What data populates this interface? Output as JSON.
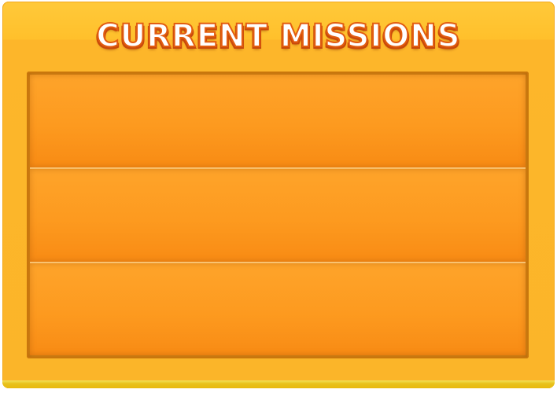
{
  "title": "CURRENT MISSIONS",
  "missions": [
    {
      "text": ""
    },
    {
      "text": ""
    },
    {
      "text": ""
    }
  ],
  "colors": {
    "panel": "#fbb529",
    "title_fill": "#ffffff",
    "title_outline": "#e35d10",
    "row": "#fd9a1f",
    "board_border": "#c9760c"
  }
}
